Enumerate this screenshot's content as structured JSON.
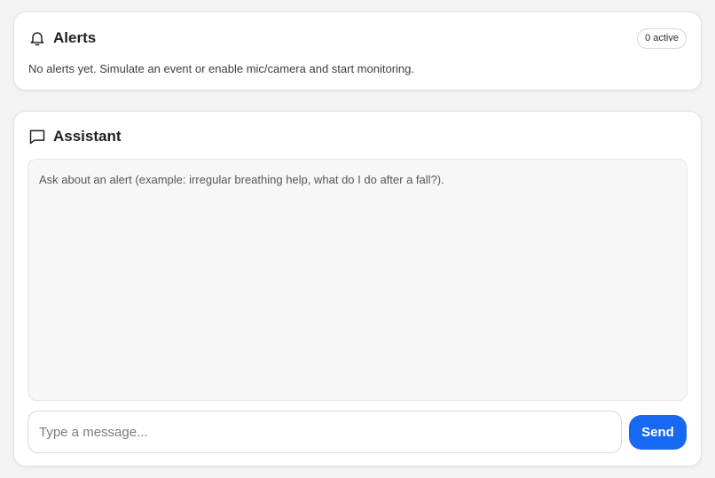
{
  "alerts": {
    "title": "Alerts",
    "icon": "bell-icon",
    "badge": "0 active",
    "empty_text": "No alerts yet. Simulate an event or enable mic/camera and start monitoring."
  },
  "assistant": {
    "title": "Assistant",
    "icon": "chat-bubble-icon",
    "hint": "Ask about an alert (example: irregular breathing help, what do I do after a fall?).",
    "input_placeholder": "Type a message...",
    "input_value": "",
    "send_label": "Send"
  },
  "colors": {
    "accent": "#1768f2",
    "background": "#f3f3f4",
    "card": "#ffffff",
    "chat_area": "#f7f7f8"
  }
}
